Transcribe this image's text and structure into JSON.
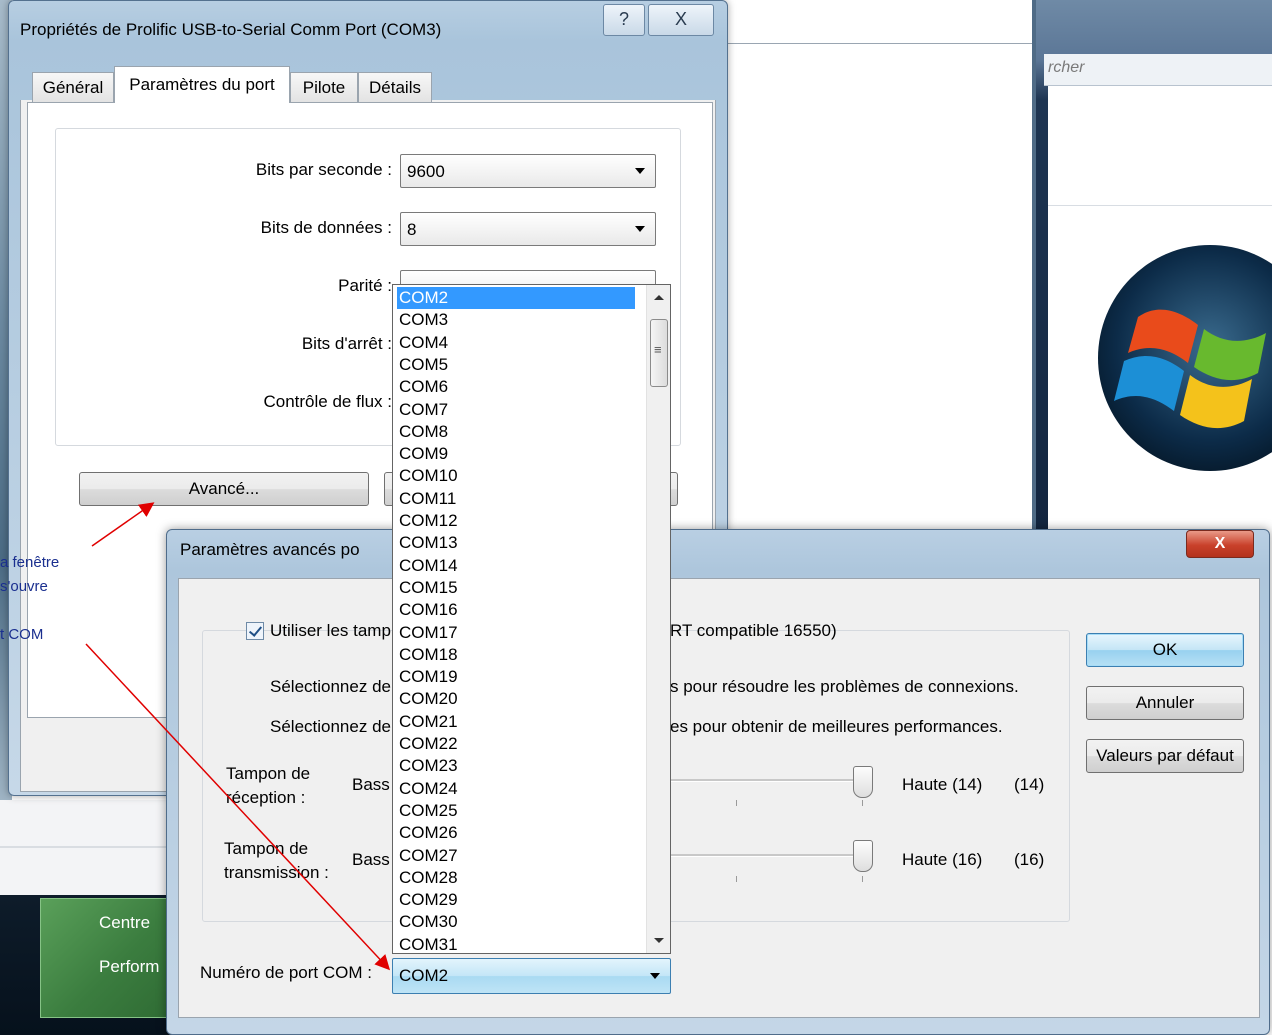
{
  "background": {
    "search_placeholder": "rcher",
    "start_items": [
      "Centre",
      "Perform"
    ]
  },
  "dialog1": {
    "title": "Propriétés de Prolific USB-to-Serial Comm Port (COM3)",
    "help_label": "?",
    "close_label": "X",
    "tabs": [
      "Général",
      "Paramètres du port",
      "Pilote",
      "Détails"
    ],
    "fields": [
      {
        "label": "Bits par seconde :",
        "value": "9600"
      },
      {
        "label": "Bits de données :",
        "value": "8"
      },
      {
        "label": "Parité :",
        "value": ""
      },
      {
        "label": "Bits d'arrêt :",
        "value": ""
      },
      {
        "label": "Contrôle de flux :",
        "value": ""
      }
    ],
    "advanced_button": "Avancé..."
  },
  "dialog2": {
    "title": "Paramètres avancés po",
    "close_label": "X",
    "fifo_checkbox": "Utiliser les tamp",
    "fifo_checkbox_suffix": "RT compatible 16550)",
    "select_low_prefix": "Sélectionnez de",
    "select_low_suffix": "s pour résoudre les problèmes de connexions.",
    "select_high_prefix": "Sélectionnez de",
    "select_high_suffix": "es pour obtenir de meilleures performances.",
    "receive": {
      "label": "Tampon de réception :",
      "low": "Bass",
      "high": "Haute (14)",
      "value": "(14)"
    },
    "transmit": {
      "label": "Tampon de transmission :",
      "low": "Bass",
      "high": "Haute (16)",
      "value": "(16)"
    },
    "ok_button": "OK",
    "cancel_button": "Annuler",
    "defaults_button": "Valeurs par défaut",
    "com_port_label": "Numéro de port COM :",
    "com_port_value": "COM2"
  },
  "dropdown": {
    "selected": "COM2",
    "items": [
      "COM2",
      "COM3",
      "COM4",
      "COM5",
      "COM6",
      "COM7",
      "COM8",
      "COM9",
      "COM10",
      "COM11",
      "COM12",
      "COM13",
      "COM14",
      "COM15",
      "COM16",
      "COM17",
      "COM18",
      "COM19",
      "COM20",
      "COM21",
      "COM22",
      "COM23",
      "COM24",
      "COM25",
      "COM26",
      "COM27",
      "COM28",
      "COM29",
      "COM30",
      "COM31"
    ]
  },
  "annotations": {
    "line1": "a fenêtre",
    "line2": "s'ouvre",
    "line3": "t COM"
  },
  "colors": {
    "selection": "#3399ff",
    "annotation_text": "#1a2f8f",
    "arrow": "#e00000"
  }
}
